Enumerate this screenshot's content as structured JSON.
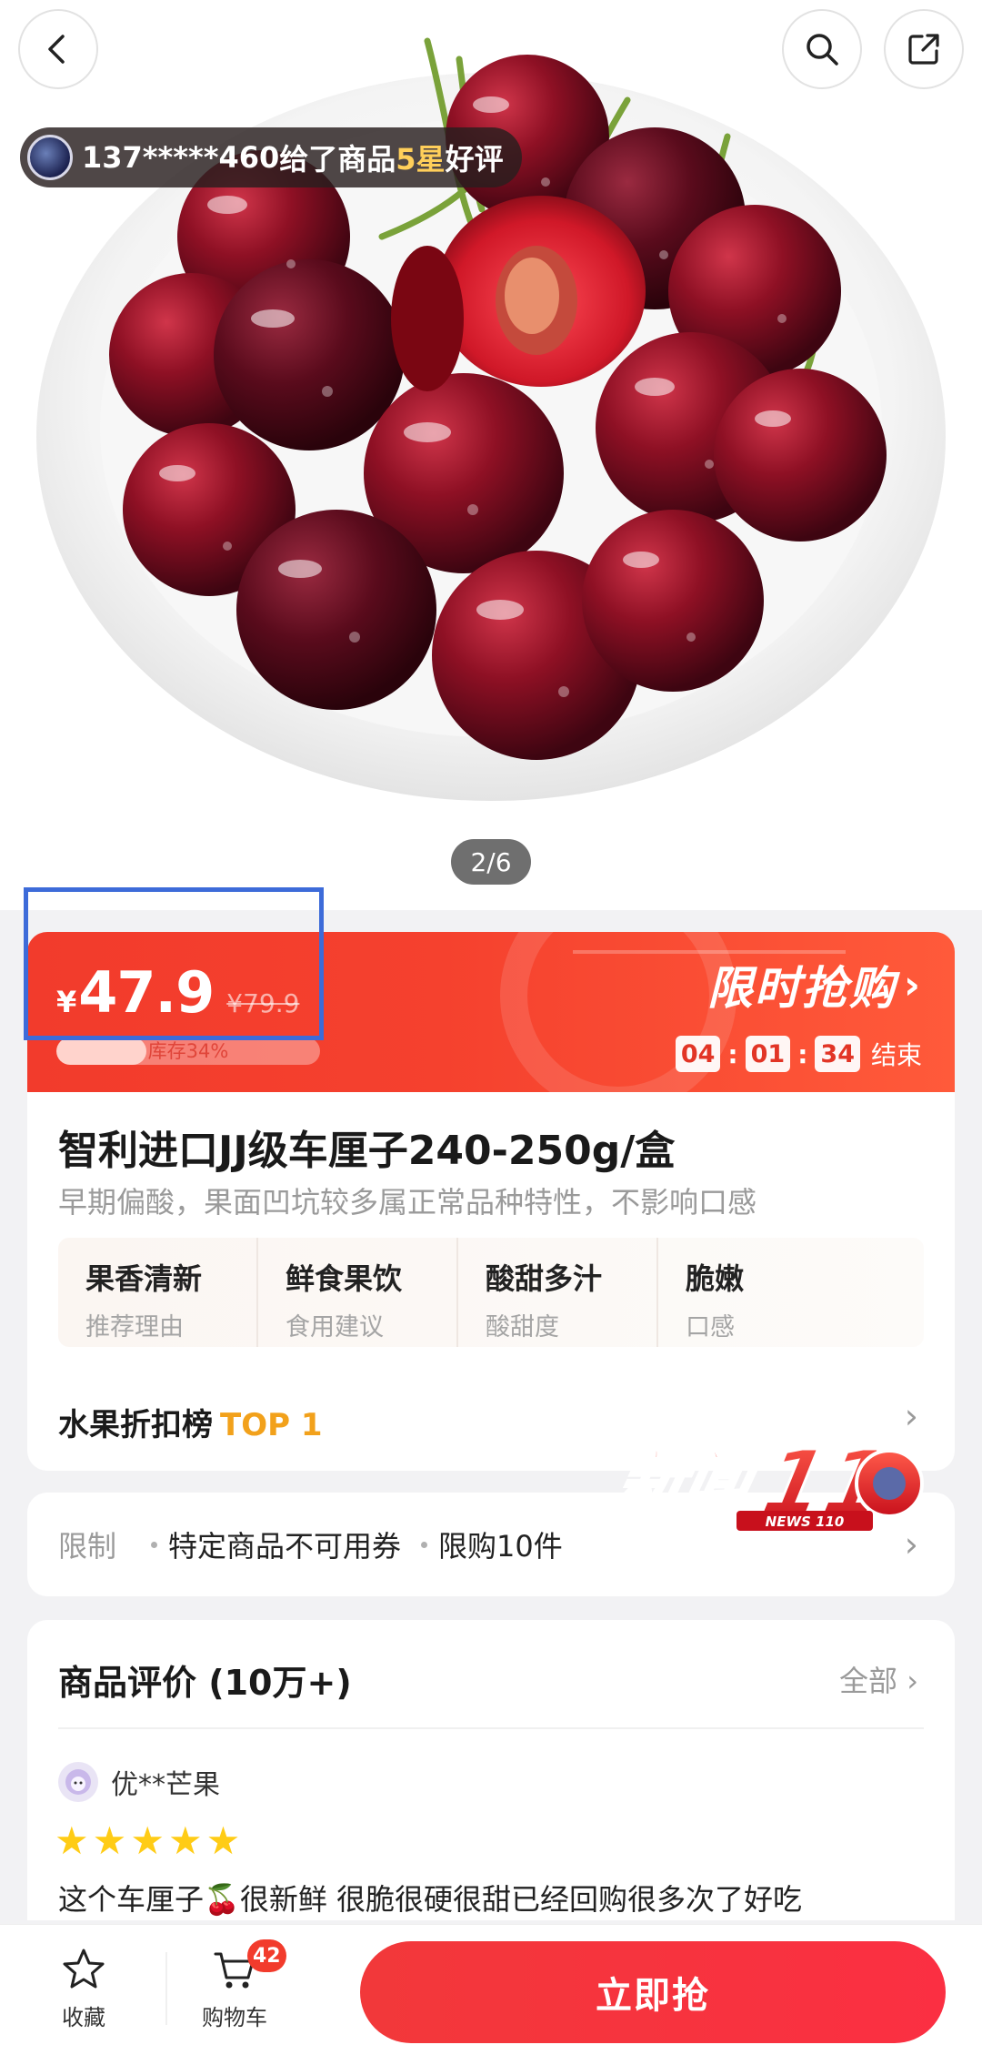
{
  "header": {
    "review_user": "137*****460",
    "review_text_prefix": " 给了商品",
    "review_stars": "5星",
    "review_text_suffix": "好评",
    "image_indicator": "2/6"
  },
  "flash_sale": {
    "currency": "¥",
    "price": "47.9",
    "original_price": "¥79.9",
    "stock_label": "库存34%",
    "stock_fraction": 0.34,
    "title": "限时抢购",
    "timer_hours": "04",
    "timer_minutes": "01",
    "timer_seconds": "34",
    "timer_suffix": "结束",
    "accent_color": "#f23b2c"
  },
  "product": {
    "title": "智利进口JJ级车厘子240-250g/盒",
    "subtitle": "早期偏酸，果面凹坑较多属正常品种特性，不影响口感",
    "attributes": [
      {
        "value": "果香清新",
        "key": "推荐理由"
      },
      {
        "value": "鲜食果饮",
        "key": "食用建议"
      },
      {
        "value": "酸甜多汁",
        "key": "酸甜度"
      },
      {
        "value": "脆嫩",
        "key": "口感"
      }
    ],
    "rank_label": "水果折扣榜",
    "rank_value": "TOP 1"
  },
  "limits": {
    "label": "限制",
    "items": [
      "特定商品不可用券",
      "限购10件"
    ]
  },
  "reviews": {
    "title": "商品评价 (10万+)",
    "all_label": "全部",
    "reviewer": "优**芒果",
    "rating": 5,
    "text": "这个车厘子🍒很新鲜 很脆很硬很甜已经回购很多次了好吃"
  },
  "watermark": {
    "text": "新闻110",
    "subtext": "NEWS 110"
  },
  "bottom_bar": {
    "favorite_label": "收藏",
    "cart_label": "购物车",
    "cart_count": "42",
    "buy_label": "立即抢"
  }
}
